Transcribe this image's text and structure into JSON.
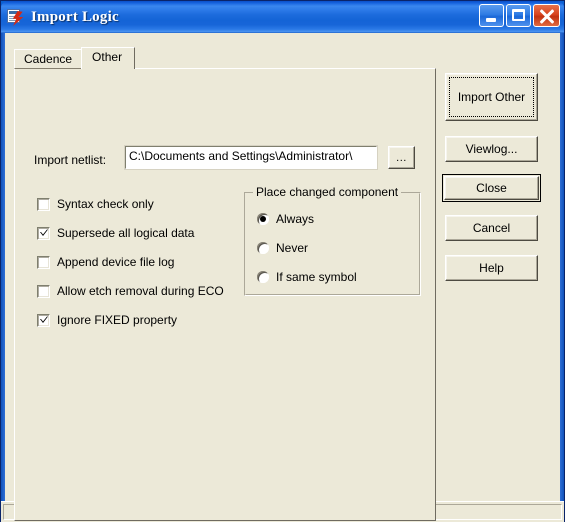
{
  "window": {
    "title": "Import Logic",
    "icon": "document-lightning-icon",
    "controls": {
      "minimize": "minimize-button",
      "maximize": "maximize-button",
      "close": "close-button"
    },
    "colors": {
      "titlebar_blue": "#1464d6",
      "dialog_face": "#ece9d8",
      "close_red": "#d8441f",
      "frame_border": "#0a246a"
    }
  },
  "tabs": [
    {
      "label": "Cadence",
      "active": false
    },
    {
      "label": "Other",
      "active": true
    }
  ],
  "form": {
    "netlist": {
      "label": "Import netlist:",
      "value": "C:\\Documents and Settings\\Administrator\\",
      "placeholder": "",
      "browse_label": "..."
    },
    "checkboxes": [
      {
        "label": "Syntax check only",
        "checked": false
      },
      {
        "label": "Supersede all logical data",
        "checked": true
      },
      {
        "label": "Append device file log",
        "checked": false
      },
      {
        "label": "Allow etch removal during ECO",
        "checked": false
      },
      {
        "label": "Ignore FIXED property",
        "checked": true
      }
    ],
    "place_changed_component": {
      "title": "Place changed component",
      "options": [
        {
          "label": "Always",
          "selected": true
        },
        {
          "label": "Never",
          "selected": false
        },
        {
          "label": "If same symbol",
          "selected": false
        }
      ]
    }
  },
  "buttons": [
    {
      "label": "Import Other",
      "focused": true,
      "default": false
    },
    {
      "label": "Viewlog...",
      "focused": false,
      "default": false
    },
    {
      "label": "Close",
      "focused": false,
      "default": true
    },
    {
      "label": "Cancel",
      "focused": false,
      "default": false
    },
    {
      "label": "Help",
      "focused": false,
      "default": false
    }
  ],
  "statusbar": {
    "pane1": "",
    "pane2": ""
  }
}
